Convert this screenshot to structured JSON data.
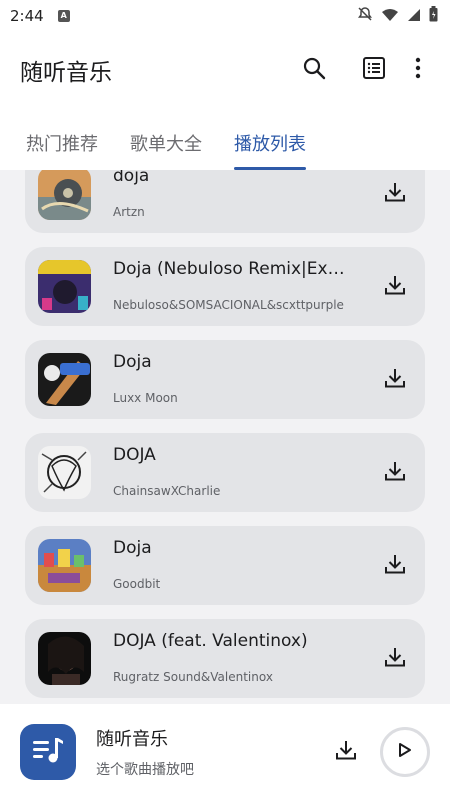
{
  "status_bar": {
    "time": "2:44",
    "notification_icon": "A"
  },
  "app_bar": {
    "title": "随听音乐"
  },
  "tabs": [
    {
      "label": "热门推荐",
      "active": false
    },
    {
      "label": "歌单大全",
      "active": false
    },
    {
      "label": "播放列表",
      "active": true
    }
  ],
  "songs": [
    {
      "title": "doja",
      "artist": "Artzn"
    },
    {
      "title": "Doja (Nebuloso Remix|Explicit)",
      "artist": "Nebuloso&SOMSACIONAL&scxttpurple"
    },
    {
      "title": "Doja",
      "artist": "Luxx Moon"
    },
    {
      "title": "DOJA",
      "artist": "ChainsawXCharlie"
    },
    {
      "title": "Doja",
      "artist": "Goodbit"
    },
    {
      "title": "DOJA (feat. Valentinox)",
      "artist": "Rugratz Sound&Valentinox"
    }
  ],
  "player": {
    "title": "随听音乐",
    "subtitle": "选个歌曲播放吧"
  },
  "colors": {
    "accent": "#2e5aa8",
    "card": "#e3e4e7",
    "list_bg": "#f2f2f4"
  }
}
